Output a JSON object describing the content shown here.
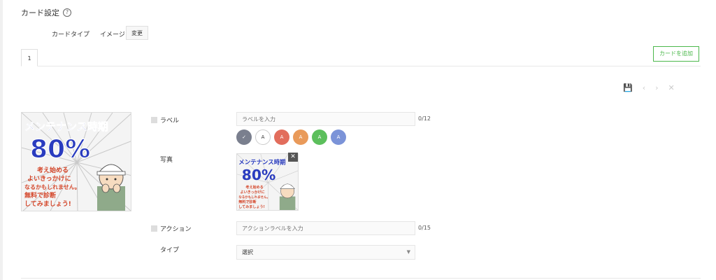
{
  "header": {
    "title": "カード設定",
    "help_icon": "help-circle-icon"
  },
  "card_type": {
    "label": "カードタイプ",
    "value": "イメージ",
    "change_label": "変更"
  },
  "tabs": [
    {
      "label": "1"
    }
  ],
  "add_card_label": "カードを追加",
  "toolbar": {
    "icons": [
      "save-icon",
      "chevron-left-icon",
      "chevron-right-icon",
      "close-icon"
    ]
  },
  "image": {
    "headline": "メンテナンス時期",
    "percent": "80%",
    "lines": [
      "考え始める",
      "よいきっかけに",
      "なるかもしれません。",
      "無料で診断",
      "してみましょう!"
    ]
  },
  "form": {
    "label_field": {
      "label": "ラベル",
      "placeholder": "ラベルを入力",
      "counter": "0/12"
    },
    "colors": [
      {
        "text": "✓",
        "color": "#7a7f8e"
      },
      {
        "text": "A",
        "color": "#ffffff"
      },
      {
        "text": "A",
        "color": "#e26d5c"
      },
      {
        "text": "A",
        "color": "#e99a5a"
      },
      {
        "text": "A",
        "color": "#5cbf5c"
      },
      {
        "text": "A",
        "color": "#7b93d8"
      }
    ],
    "photo_label": "写真",
    "action_field": {
      "label": "アクション",
      "placeholder": "アクションラベルを入力",
      "counter": "0/15"
    },
    "type_field": {
      "label": "タイプ",
      "selected": "選択"
    }
  },
  "accent_color": "#4cb84c"
}
